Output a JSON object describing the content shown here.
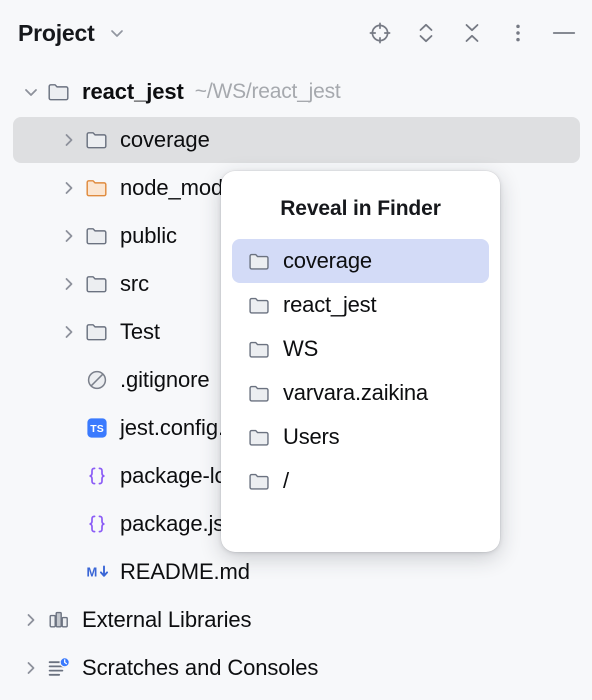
{
  "toolbar": {
    "title": "Project",
    "title_chevron_icon": "chevron-down-icon",
    "actions": [
      {
        "name": "select-opened-file-button",
        "icon": "crosshair-target-icon",
        "label": "Select Opened File"
      },
      {
        "name": "expand-all-button",
        "icon": "expand-all-chevrons-icon",
        "label": "Expand All"
      },
      {
        "name": "collapse-all-button",
        "icon": "collapse-all-chevrons-icon",
        "label": "Collapse All"
      },
      {
        "name": "more-options-button",
        "icon": "vertical-dots-icon",
        "label": "Options"
      },
      {
        "name": "hide-panel-button",
        "icon": "minus-dash-icon",
        "label": "Hide"
      }
    ]
  },
  "tree": {
    "root": {
      "label": "react_jest",
      "path": "~/WS/react_jest",
      "icon": "folder-icon",
      "expanded": true
    },
    "children": [
      {
        "label": "coverage",
        "icon": "folder-icon",
        "twisty": "collapsed",
        "selected": true
      },
      {
        "label": "node_modules",
        "icon": "folder-orange-icon",
        "twisty": "collapsed",
        "selected": false
      },
      {
        "label": "public",
        "icon": "folder-icon",
        "twisty": "collapsed",
        "selected": false
      },
      {
        "label": "src",
        "icon": "folder-icon",
        "twisty": "collapsed",
        "selected": false
      },
      {
        "label": "Test",
        "icon": "folder-icon",
        "twisty": "collapsed",
        "selected": false
      },
      {
        "label": ".gitignore",
        "icon": "ignored-file-icon",
        "twisty": "none",
        "selected": false
      },
      {
        "label": "jest.config.ts",
        "icon": "typescript-file-icon",
        "twisty": "none",
        "selected": false
      },
      {
        "label": "package-lock.json",
        "icon": "json-file-icon",
        "twisty": "none",
        "selected": false
      },
      {
        "label": "package.json",
        "icon": "json-file-icon",
        "twisty": "none",
        "selected": false
      },
      {
        "label": "README.md",
        "icon": "markdown-file-icon",
        "twisty": "none",
        "selected": false
      }
    ],
    "bottom": [
      {
        "label": "External Libraries",
        "icon": "library-books-icon",
        "twisty": "collapsed"
      },
      {
        "label": "Scratches and Consoles",
        "icon": "scratches-clock-icon",
        "twisty": "collapsed"
      }
    ]
  },
  "popup": {
    "title": "Reveal in Finder",
    "items": [
      {
        "label": "coverage",
        "icon": "folder-icon",
        "selected": true
      },
      {
        "label": "react_jest",
        "icon": "folder-icon",
        "selected": false
      },
      {
        "label": "WS",
        "icon": "folder-icon",
        "selected": false
      },
      {
        "label": "varvara.zaikina",
        "icon": "folder-icon",
        "selected": false
      },
      {
        "label": "Users",
        "icon": "folder-icon",
        "selected": false
      },
      {
        "label": "/",
        "icon": "folder-icon",
        "selected": false
      }
    ]
  },
  "colors": {
    "background": "#f7f8fa",
    "selected_row": "#dedfe1",
    "popup_selected": "#d3dbf7",
    "folder_outline": "#6b7280",
    "folder_orange": "#e08b3e",
    "typescript_blue": "#3a7afe",
    "json_purple": "#8b5cf6",
    "markdown_blue": "#3a66d6",
    "muted_text": "#a6a9ae"
  }
}
